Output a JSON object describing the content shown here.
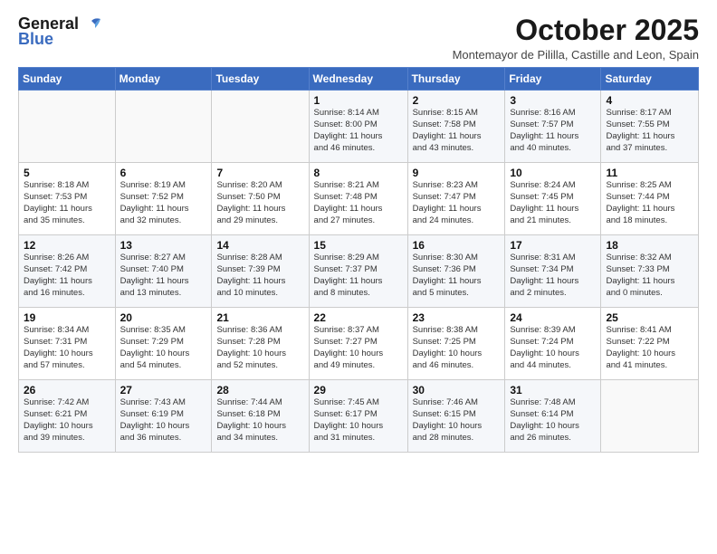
{
  "header": {
    "logo_line1": "General",
    "logo_line2": "Blue",
    "month_title": "October 2025",
    "subtitle": "Montemayor de Pililla, Castille and Leon, Spain"
  },
  "weekdays": [
    "Sunday",
    "Monday",
    "Tuesday",
    "Wednesday",
    "Thursday",
    "Friday",
    "Saturday"
  ],
  "weeks": [
    [
      {
        "day": "",
        "info": ""
      },
      {
        "day": "",
        "info": ""
      },
      {
        "day": "",
        "info": ""
      },
      {
        "day": "1",
        "info": "Sunrise: 8:14 AM\nSunset: 8:00 PM\nDaylight: 11 hours\nand 46 minutes."
      },
      {
        "day": "2",
        "info": "Sunrise: 8:15 AM\nSunset: 7:58 PM\nDaylight: 11 hours\nand 43 minutes."
      },
      {
        "day": "3",
        "info": "Sunrise: 8:16 AM\nSunset: 7:57 PM\nDaylight: 11 hours\nand 40 minutes."
      },
      {
        "day": "4",
        "info": "Sunrise: 8:17 AM\nSunset: 7:55 PM\nDaylight: 11 hours\nand 37 minutes."
      }
    ],
    [
      {
        "day": "5",
        "info": "Sunrise: 8:18 AM\nSunset: 7:53 PM\nDaylight: 11 hours\nand 35 minutes."
      },
      {
        "day": "6",
        "info": "Sunrise: 8:19 AM\nSunset: 7:52 PM\nDaylight: 11 hours\nand 32 minutes."
      },
      {
        "day": "7",
        "info": "Sunrise: 8:20 AM\nSunset: 7:50 PM\nDaylight: 11 hours\nand 29 minutes."
      },
      {
        "day": "8",
        "info": "Sunrise: 8:21 AM\nSunset: 7:48 PM\nDaylight: 11 hours\nand 27 minutes."
      },
      {
        "day": "9",
        "info": "Sunrise: 8:23 AM\nSunset: 7:47 PM\nDaylight: 11 hours\nand 24 minutes."
      },
      {
        "day": "10",
        "info": "Sunrise: 8:24 AM\nSunset: 7:45 PM\nDaylight: 11 hours\nand 21 minutes."
      },
      {
        "day": "11",
        "info": "Sunrise: 8:25 AM\nSunset: 7:44 PM\nDaylight: 11 hours\nand 18 minutes."
      }
    ],
    [
      {
        "day": "12",
        "info": "Sunrise: 8:26 AM\nSunset: 7:42 PM\nDaylight: 11 hours\nand 16 minutes."
      },
      {
        "day": "13",
        "info": "Sunrise: 8:27 AM\nSunset: 7:40 PM\nDaylight: 11 hours\nand 13 minutes."
      },
      {
        "day": "14",
        "info": "Sunrise: 8:28 AM\nSunset: 7:39 PM\nDaylight: 11 hours\nand 10 minutes."
      },
      {
        "day": "15",
        "info": "Sunrise: 8:29 AM\nSunset: 7:37 PM\nDaylight: 11 hours\nand 8 minutes."
      },
      {
        "day": "16",
        "info": "Sunrise: 8:30 AM\nSunset: 7:36 PM\nDaylight: 11 hours\nand 5 minutes."
      },
      {
        "day": "17",
        "info": "Sunrise: 8:31 AM\nSunset: 7:34 PM\nDaylight: 11 hours\nand 2 minutes."
      },
      {
        "day": "18",
        "info": "Sunrise: 8:32 AM\nSunset: 7:33 PM\nDaylight: 11 hours\nand 0 minutes."
      }
    ],
    [
      {
        "day": "19",
        "info": "Sunrise: 8:34 AM\nSunset: 7:31 PM\nDaylight: 10 hours\nand 57 minutes."
      },
      {
        "day": "20",
        "info": "Sunrise: 8:35 AM\nSunset: 7:29 PM\nDaylight: 10 hours\nand 54 minutes."
      },
      {
        "day": "21",
        "info": "Sunrise: 8:36 AM\nSunset: 7:28 PM\nDaylight: 10 hours\nand 52 minutes."
      },
      {
        "day": "22",
        "info": "Sunrise: 8:37 AM\nSunset: 7:27 PM\nDaylight: 10 hours\nand 49 minutes."
      },
      {
        "day": "23",
        "info": "Sunrise: 8:38 AM\nSunset: 7:25 PM\nDaylight: 10 hours\nand 46 minutes."
      },
      {
        "day": "24",
        "info": "Sunrise: 8:39 AM\nSunset: 7:24 PM\nDaylight: 10 hours\nand 44 minutes."
      },
      {
        "day": "25",
        "info": "Sunrise: 8:41 AM\nSunset: 7:22 PM\nDaylight: 10 hours\nand 41 minutes."
      }
    ],
    [
      {
        "day": "26",
        "info": "Sunrise: 7:42 AM\nSunset: 6:21 PM\nDaylight: 10 hours\nand 39 minutes."
      },
      {
        "day": "27",
        "info": "Sunrise: 7:43 AM\nSunset: 6:19 PM\nDaylight: 10 hours\nand 36 minutes."
      },
      {
        "day": "28",
        "info": "Sunrise: 7:44 AM\nSunset: 6:18 PM\nDaylight: 10 hours\nand 34 minutes."
      },
      {
        "day": "29",
        "info": "Sunrise: 7:45 AM\nSunset: 6:17 PM\nDaylight: 10 hours\nand 31 minutes."
      },
      {
        "day": "30",
        "info": "Sunrise: 7:46 AM\nSunset: 6:15 PM\nDaylight: 10 hours\nand 28 minutes."
      },
      {
        "day": "31",
        "info": "Sunrise: 7:48 AM\nSunset: 6:14 PM\nDaylight: 10 hours\nand 26 minutes."
      },
      {
        "day": "",
        "info": ""
      }
    ]
  ]
}
